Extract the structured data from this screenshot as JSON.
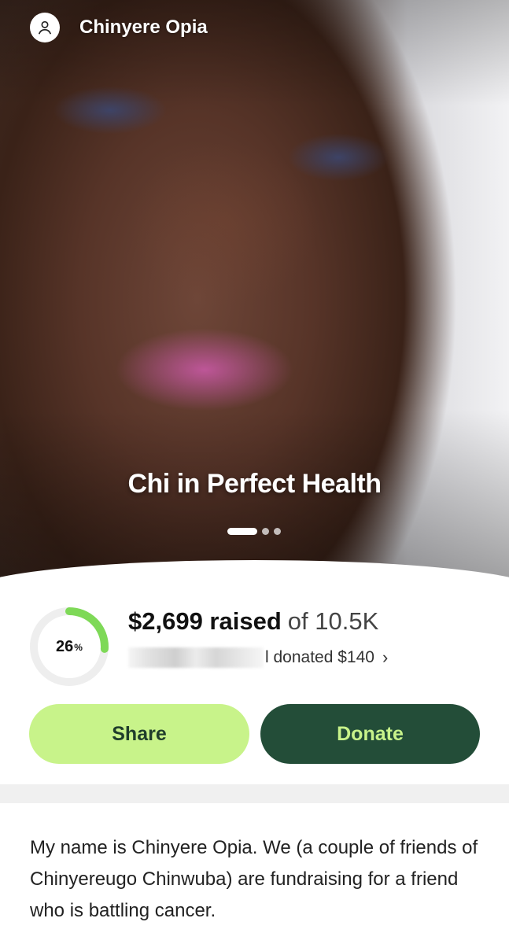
{
  "profile": {
    "name": "Chinyere Opia",
    "icon": "user-icon"
  },
  "hero": {
    "title": "Chi in Perfect Health",
    "slides": 3,
    "active_slide": 1
  },
  "fundraiser": {
    "progress_percent": 26,
    "progress_label": "26",
    "progress_unit": "%",
    "raised": "$2,699 raised",
    "goal": "of 10.5K",
    "recent_donation": "l donated $140",
    "chevron": "›"
  },
  "actions": {
    "share_label": "Share",
    "donate_label": "Donate"
  },
  "story": {
    "text": "My name is Chinyere Opia. We (a couple of friends of Chinyereugo Chinwuba) are fundraising for a friend who is battling cancer."
  },
  "colors": {
    "accent_green": "#7ed957",
    "share_bg": "#c8f38a",
    "donate_bg": "#234d38"
  }
}
